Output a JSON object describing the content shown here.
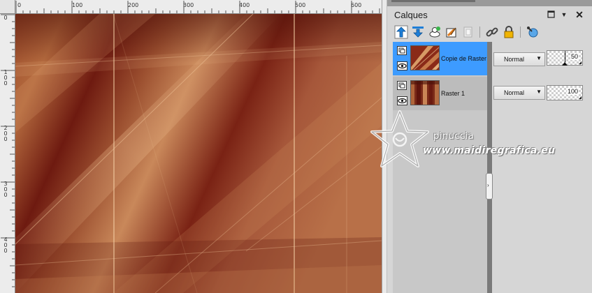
{
  "ruler": {
    "top_labels": [
      "0",
      "100",
      "200",
      "300",
      "400",
      "500",
      "600"
    ],
    "left_labels": [
      "0",
      "1\n0\n0",
      "2\n0\n0",
      "3\n0\n0",
      "4\n0\n0"
    ]
  },
  "panel": {
    "title": "Calques",
    "pin_glyph": "◘",
    "dropdown_glyph": "▼",
    "close_glyph": "✕"
  },
  "toolbar": {
    "buttons": [
      {
        "icon": "move-layer-up-icon"
      },
      {
        "icon": "move-layer-down-icon"
      },
      {
        "icon": "new-layer-icon"
      },
      {
        "icon": "new-adjustment-layer-icon"
      },
      {
        "icon": "delete-layer-icon"
      },
      {
        "icon": "link-layers-icon"
      },
      {
        "icon": "lock-layer-icon"
      },
      {
        "icon": "layer-properties-icon"
      }
    ]
  },
  "layers": [
    {
      "name": "Copie de Raster",
      "blend": "Normal",
      "opacity": "50",
      "selected": true
    },
    {
      "name": "Raster 1",
      "blend": "Normal",
      "opacity": "100",
      "selected": false
    }
  ],
  "scroll_grip": "›",
  "watermark": {
    "name": "pinuccia",
    "url": "www.maidiregrafica.eu"
  },
  "colors": {
    "selected_row": "#3d9bff",
    "accent_icon": "#1e7fd8"
  }
}
